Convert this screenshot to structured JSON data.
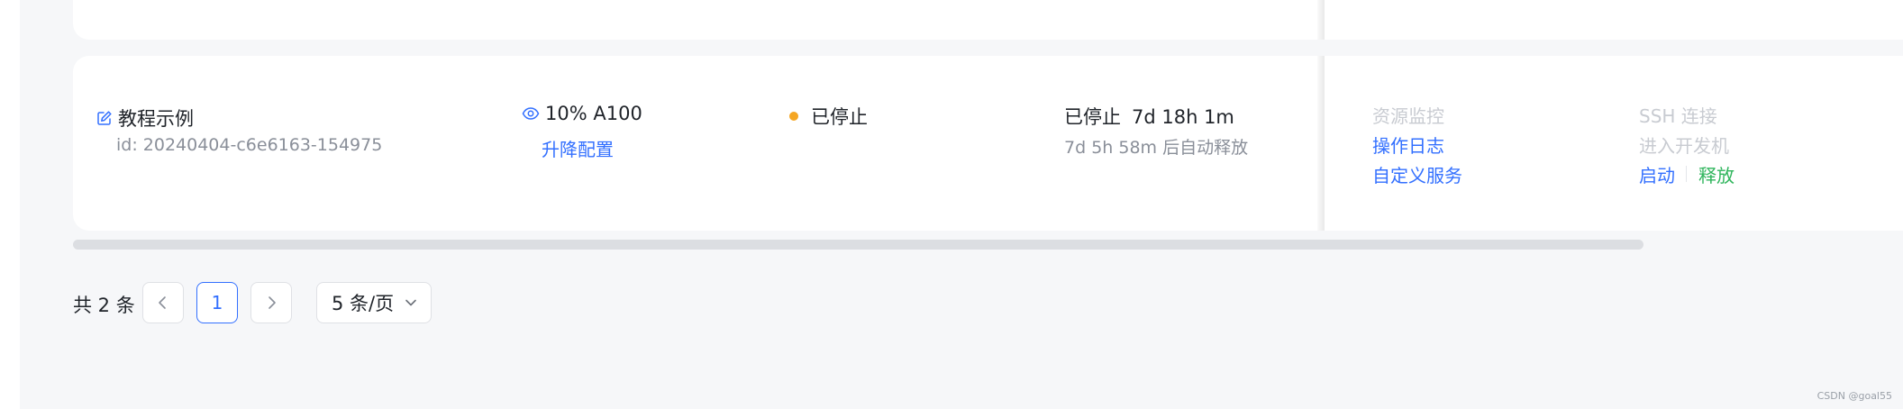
{
  "instance": {
    "name": "教程示例",
    "id_text": "id: 20240404-c6e6163-154975",
    "gpu": "10% A100",
    "upgrade_label": "升降配置",
    "status": "已停止",
    "runtime_status": "已停止",
    "runtime_duration": "7d 18h 1m",
    "auto_release": "7d 5h 58m 后自动释放",
    "status_color": "#f5a623"
  },
  "actions": {
    "monitor": "资源监控",
    "ssh": "SSH 连接",
    "log": "操作日志",
    "devmachine": "进入开发机",
    "custom_service": "自定义服务",
    "start": "启动",
    "release": "释放"
  },
  "pagination": {
    "total": "共 2 条",
    "current_page": "1",
    "page_size": "5 条/页"
  },
  "watermark": "CSDN @goal55",
  "colors": {
    "link": "#3370ff",
    "disabled": "#c8cbd1",
    "release": "#2fb55c",
    "background": "#f6f7f9"
  },
  "icons": {
    "name": "edit-icon",
    "gpu": "eye-icon",
    "prev": "chevron-left-icon",
    "next": "chevron-right-icon",
    "select": "chevron-down-icon"
  }
}
